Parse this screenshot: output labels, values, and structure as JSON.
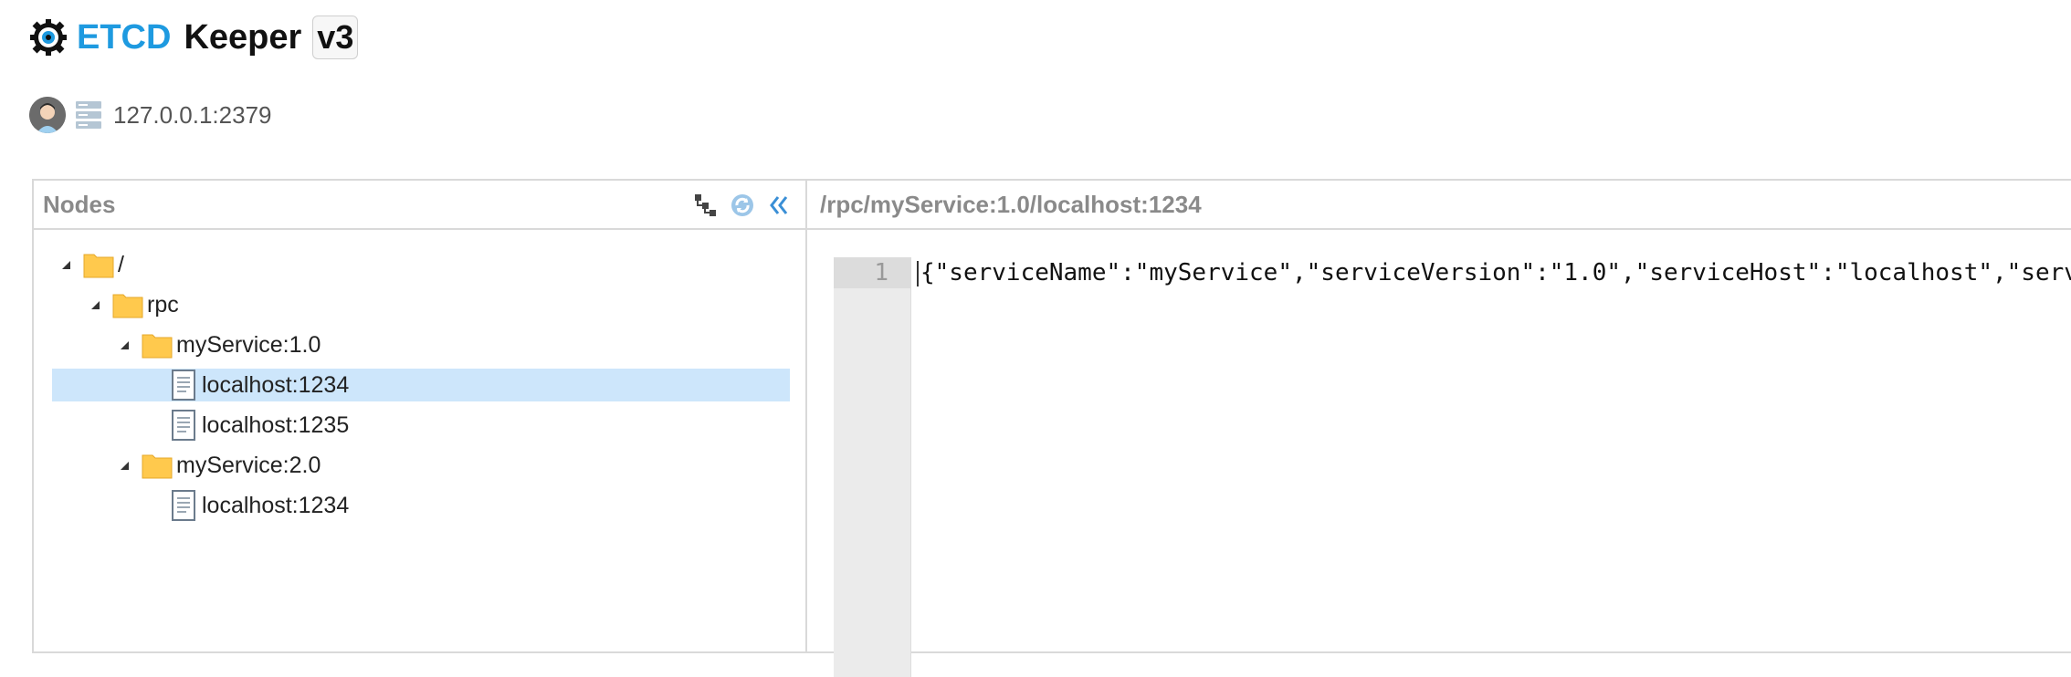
{
  "header": {
    "title_part1": "ETCD",
    "title_part2": "Keeper",
    "version": "v3",
    "logo_icon": "gear-eye-icon"
  },
  "connection": {
    "avatar_icon": "user-avatar-icon",
    "server_icon": "server-icon",
    "address": "127.0.0.1:2379"
  },
  "nodes_panel": {
    "title": "Nodes",
    "tools": [
      "tree-expand-icon",
      "refresh-icon",
      "collapse-left-icon"
    ],
    "tree": [
      {
        "label": "/",
        "type": "folder"
      },
      {
        "label": "rpc",
        "type": "folder"
      },
      {
        "label": "myService:1.0",
        "type": "folder"
      },
      {
        "label": "localhost:1234",
        "type": "file",
        "selected": true
      },
      {
        "label": "localhost:1235",
        "type": "file"
      },
      {
        "label": "myService:2.0",
        "type": "folder"
      },
      {
        "label": "localhost:1234",
        "type": "file"
      }
    ]
  },
  "editor": {
    "path": "/rpc/myService:1.0/localhost:1234",
    "line_number": "1",
    "content": "{\"serviceName\":\"myService\",\"serviceVersion\":\"1.0\",\"serviceHost\":\"localhost\",\"serv"
  },
  "colors": {
    "accent": "#1e9ae0",
    "selection": "#cde6fb",
    "folder": "#ffc94d",
    "border": "#d9d9d9"
  }
}
